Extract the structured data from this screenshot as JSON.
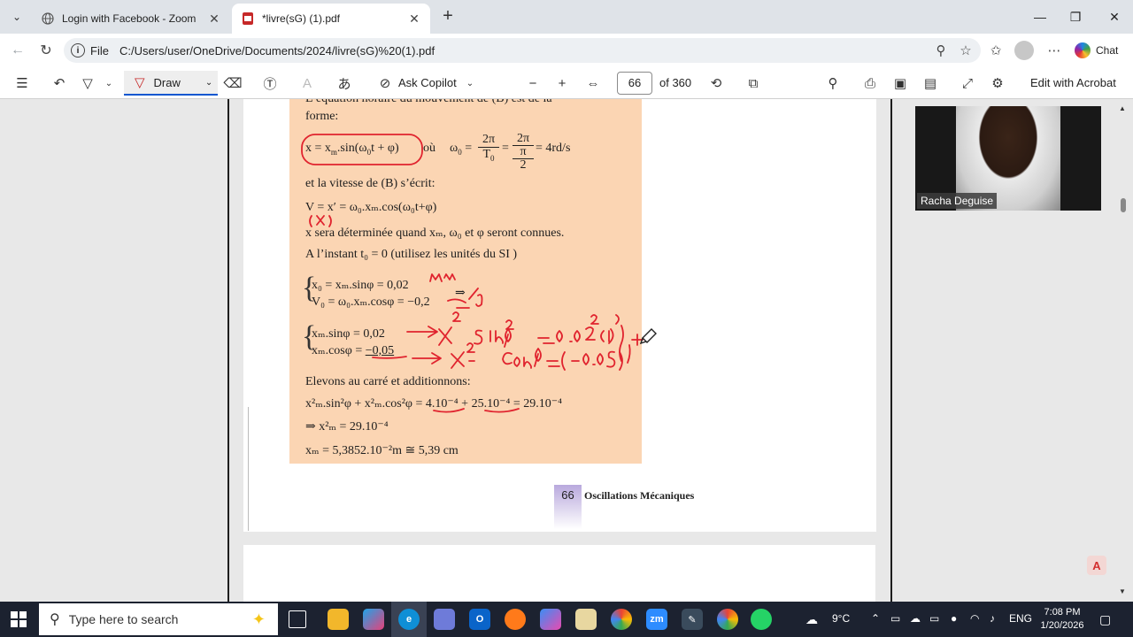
{
  "browser": {
    "tabs": [
      {
        "title": "Login with Facebook - Zoom",
        "icon": "globe-icon"
      },
      {
        "title": "*livre(sG) (1).pdf",
        "icon": "pdf-icon",
        "active": true
      }
    ],
    "address": {
      "scheme_label": "File",
      "url": "C:/Users/user/OneDrive/Documents/2024/livre(sG)%20(1).pdf"
    },
    "chat_label": "Chat"
  },
  "pdf_toolbar": {
    "draw_label": "Draw",
    "ask_copilot_label": "Ask Copilot",
    "page_number": "66",
    "page_total": "of 360",
    "edit_label": "Edit with Acrobat"
  },
  "page": {
    "lines": {
      "l1": "L’équation horaire du mouvement de (B) est de la",
      "l2": "forme:",
      "l3_oo": "où",
      "l3_rhs": "= 4rd/s",
      "l4": "et la vitesse de (B) s’écrit:",
      "l5": "V = x′ = ω₀.xₘ.cos(ω₀t+φ)",
      "l6": "x sera déterminée quand xₘ, ω₀ et φ seront connues.",
      "l7": "A l’instant t₀ = 0 (utilisez les unités du SI )",
      "l8": "x₀ = xₘ.sinφ = 0,02",
      "l9": "V₀ = ω₀.xₘ.cosφ = −0,2",
      "l9_arrow": "⇒",
      "l10": "xₘ.sinφ = 0,02",
      "l11_a": "xₘ.cosφ = ",
      "l11_b": "−0,05",
      "l12": "Elevons au carré et additionnons:",
      "l13": "x²ₘ.sin²φ + x²ₘ.cos²φ = 4.10⁻⁴ + 25.10⁻⁴ = 29.10⁻⁴",
      "l14": "⇒ x²ₘ = 29.10⁻⁴",
      "l15": "xₘ = 5,3852.10⁻²m ≅ 5,39 cm"
    },
    "footer": {
      "page_num": "66",
      "title": "Oscillations Mécaniques"
    }
  },
  "video": {
    "participant_name": "Racha Deguise"
  },
  "taskbar": {
    "search_placeholder": "Type here to search",
    "weather": "9°C",
    "language": "ENG",
    "time": "7:08 PM",
    "date": "1/20/2026"
  },
  "colors": {
    "accent": "#0b57d0",
    "ink": "#e0232e",
    "highlight_box": "#fbd5b3",
    "taskbar": "#1c2230"
  }
}
